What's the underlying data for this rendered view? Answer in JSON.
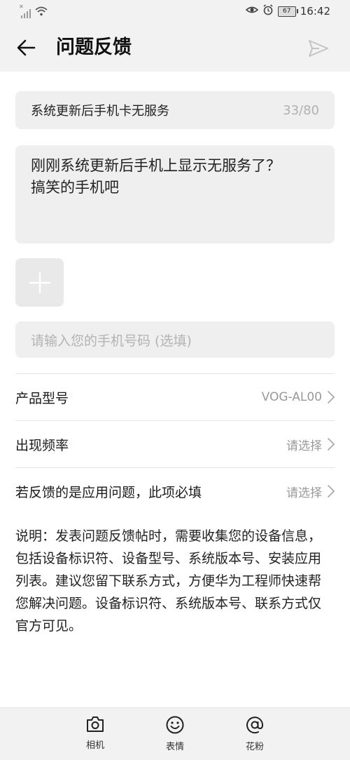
{
  "status_bar": {
    "time": "16:42",
    "battery": "67",
    "sim_mark": "✕"
  },
  "header": {
    "title": "问题反馈"
  },
  "form": {
    "title_value": "系统更新后手机卡无服务",
    "title_counter": "33/80",
    "description_line1": "刚刚系统更新后手机上显示无服务了？",
    "description_line2": "搞笑的手机吧",
    "phone_placeholder": "请输入您的手机号码 (选填)"
  },
  "rows": [
    {
      "label": "产品型号",
      "value": "VOG-AL00"
    },
    {
      "label": "出现频率",
      "value": "请选择"
    },
    {
      "label": "若反馈的是应用问题，此项必填",
      "value": "请选择"
    }
  ],
  "note": "说明：发表问题反馈帖时，需要收集您的设备信息，包括设备标识符、设备型号、系统版本号、安装应用列表。建议您留下联系方式，方便华为工程师快速帮您解决问题。设备标识符、系统版本号、联系方式仅官方可见。",
  "toolbar": [
    {
      "label": "相机",
      "icon": "camera-icon"
    },
    {
      "label": "表情",
      "icon": "smiley-icon"
    },
    {
      "label": "花粉",
      "icon": "at-icon"
    }
  ],
  "colors": {
    "background": "#f2f2f2",
    "field": "#efefef",
    "placeholder": "#b3b3b3",
    "secondary_text": "#999999"
  }
}
